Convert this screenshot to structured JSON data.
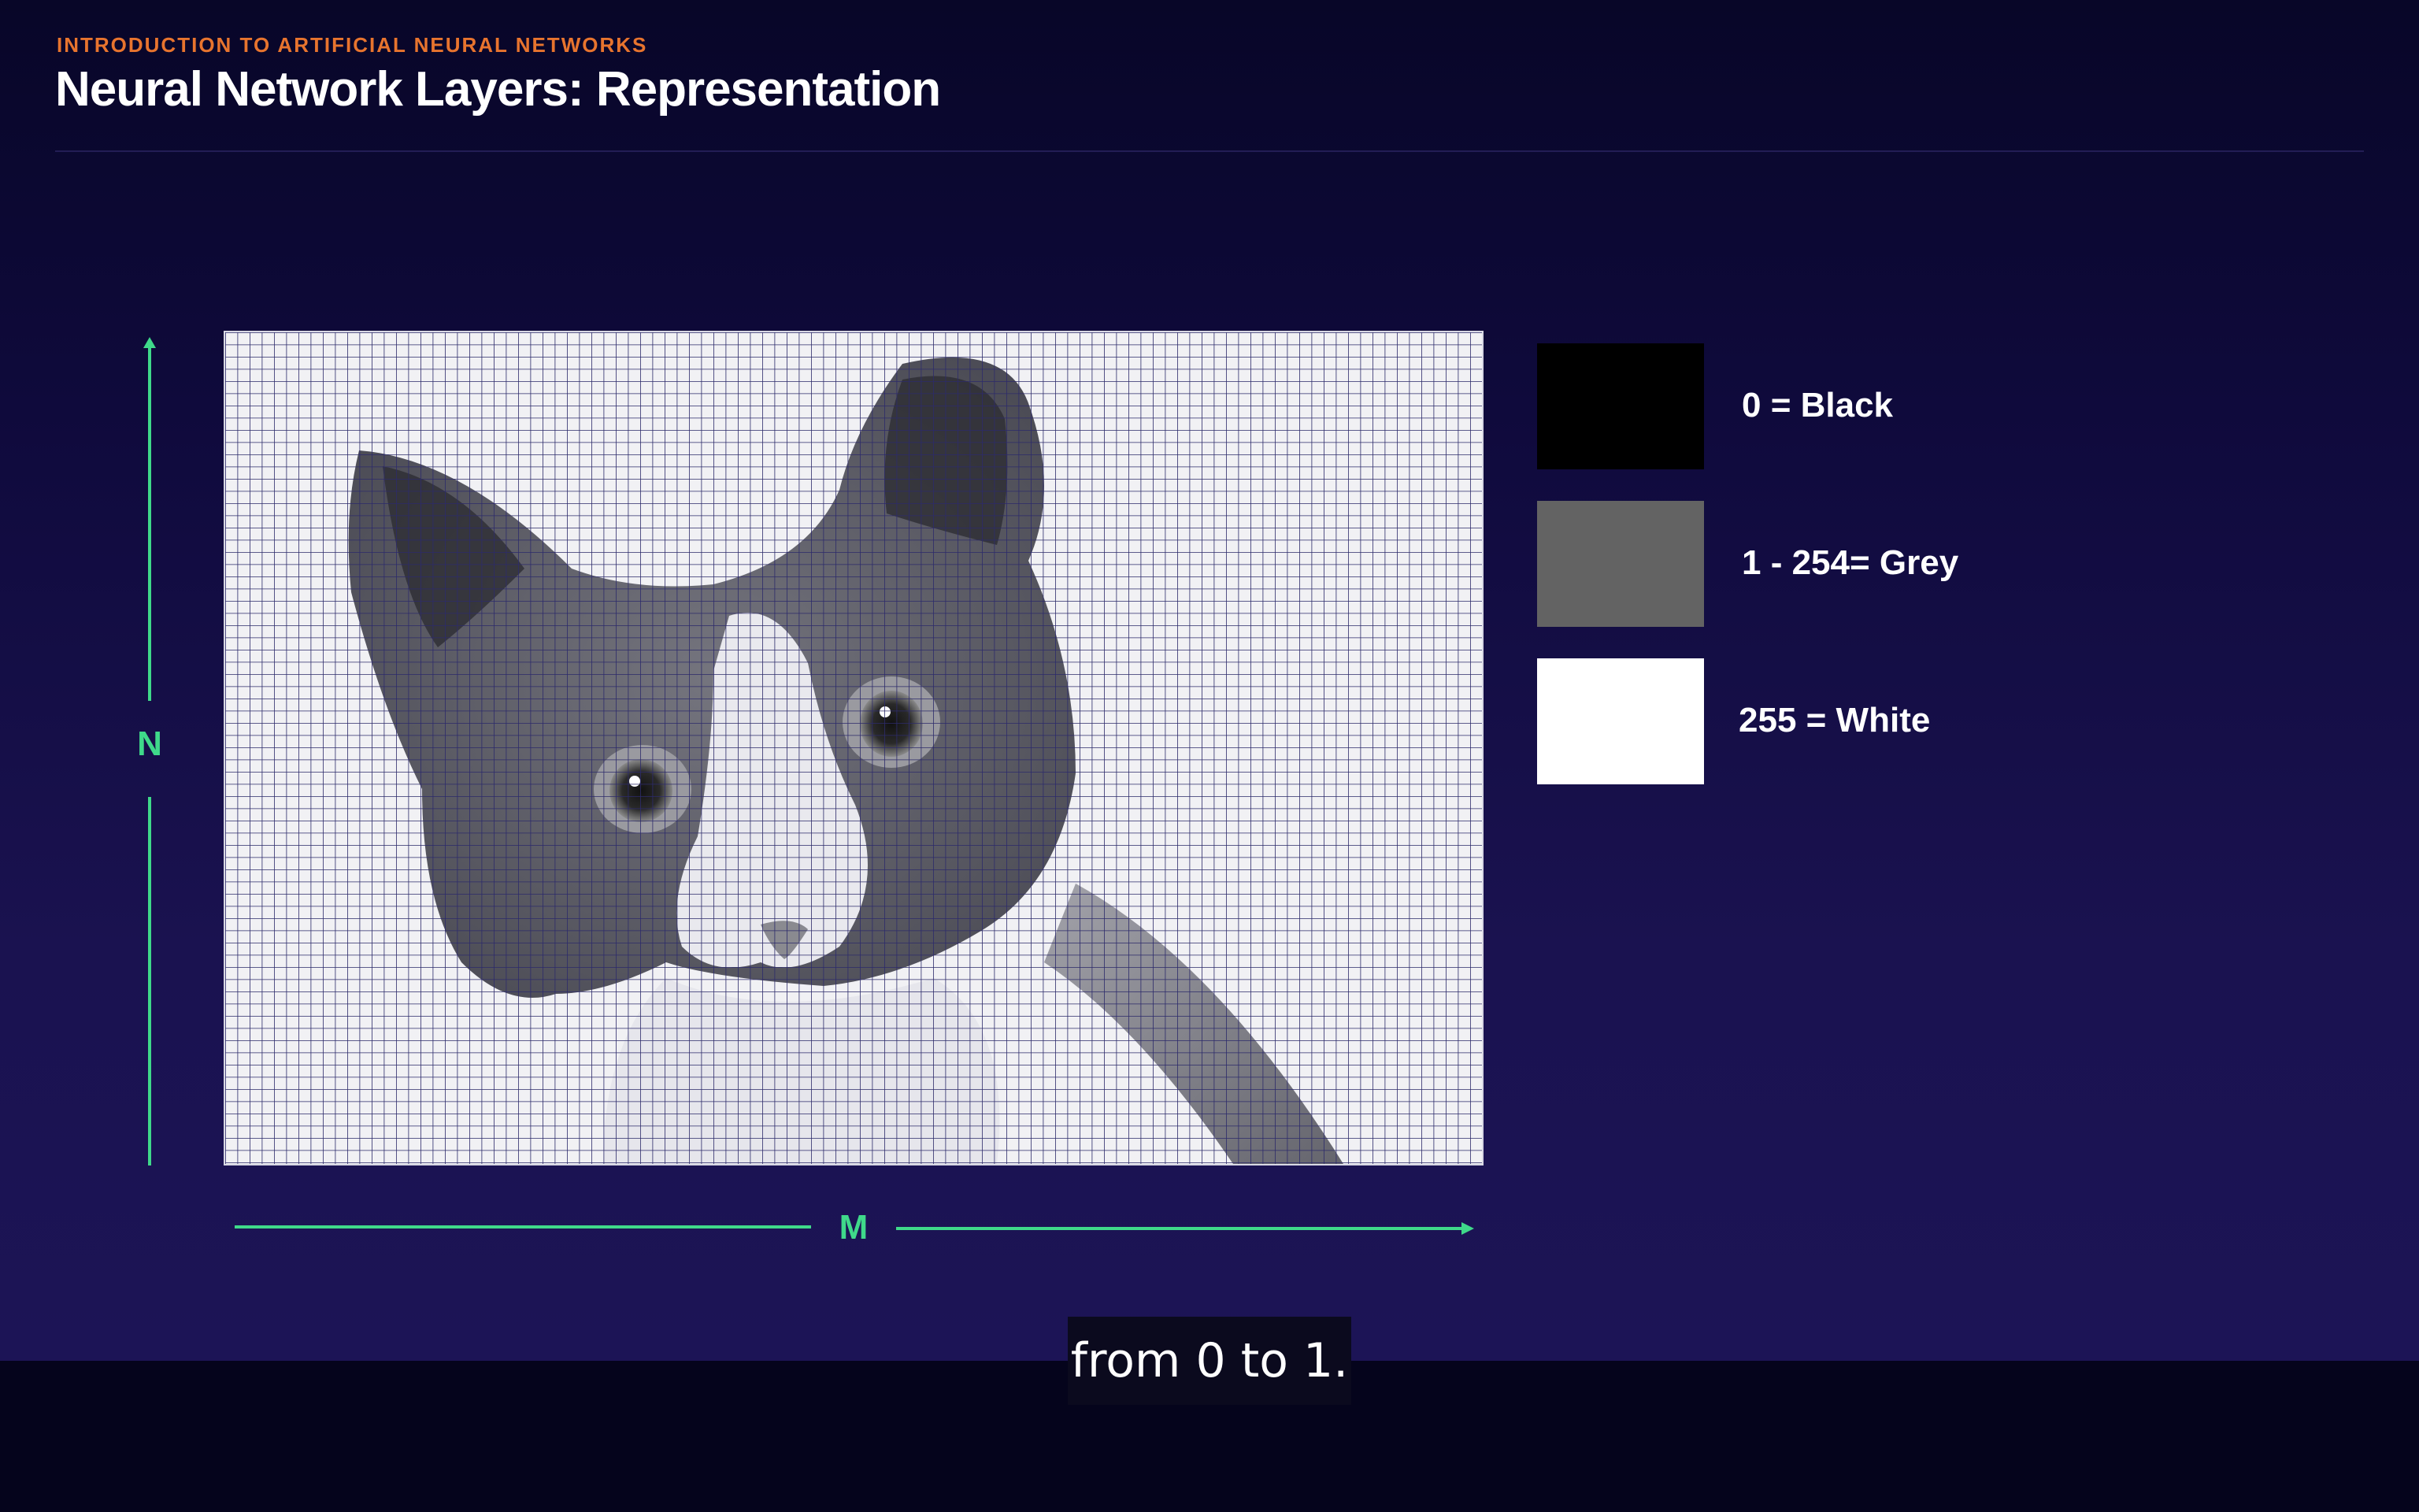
{
  "header": {
    "kicker": "INTRODUCTION TO ARTIFICIAL NEURAL NETWORKS",
    "title": "Neural Network Layers: Representation"
  },
  "diagram": {
    "image_subject": "grayscale cat photo overlaid with pixel grid",
    "vertical_axis_label": "N",
    "horizontal_axis_label": "M",
    "axis_color": "#3fd98a"
  },
  "legend": {
    "items": [
      {
        "label": "0 = Black",
        "color": "#000000"
      },
      {
        "label": "1 - 254= Grey",
        "color": "#636363"
      },
      {
        "label": "255 = White",
        "color": "#ffffff"
      }
    ]
  },
  "subtitle": {
    "text": "from 0 to 1."
  },
  "colors": {
    "accent": "#e8742e",
    "background_top": "#080628",
    "background_bottom": "#1c1456"
  }
}
